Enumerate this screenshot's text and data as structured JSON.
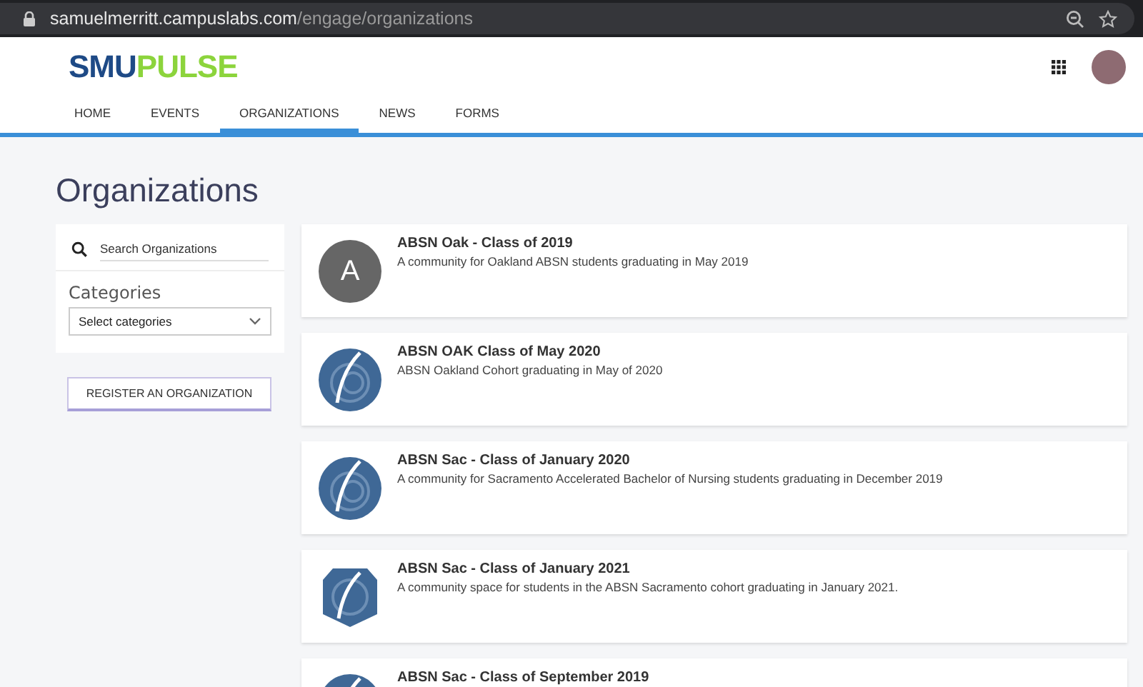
{
  "browser": {
    "url_host": "samuelmerritt.campuslabs.com",
    "url_path": "/engage/organizations"
  },
  "header": {
    "logo_primary": "SMU",
    "logo_secondary": "PULSE"
  },
  "nav": [
    {
      "label": "HOME",
      "selected": false
    },
    {
      "label": "EVENTS",
      "selected": false
    },
    {
      "label": "ORGANIZATIONS",
      "selected": true
    },
    {
      "label": "NEWS",
      "selected": false
    },
    {
      "label": "FORMS",
      "selected": false
    }
  ],
  "page_title": "Organizations",
  "sidebar": {
    "search": {
      "placeholder": "Search Organizations"
    },
    "categories_label": "Categories",
    "categories_select": "Select categories",
    "register_button": "REGISTER AN ORGANIZATION"
  },
  "organizations": [
    {
      "kind": "letter",
      "letter": "A",
      "name": "ABSN Oak - Class of 2019",
      "description": "A community for Oakland ABSN students graduating in May 2019"
    },
    {
      "kind": "round-logo",
      "name": "ABSN OAK Class of May 2020",
      "description": "ABSN Oakland Cohort graduating in May of 2020"
    },
    {
      "kind": "round-logo",
      "name": "ABSN Sac - Class of January 2020",
      "description": "A community for Sacramento Accelerated Bachelor of Nursing students graduating in December 2019"
    },
    {
      "kind": "shield-logo",
      "name": "ABSN Sac - Class of January 2021",
      "description": "A community space for students in the ABSN Sacramento cohort graduating in January 2021."
    },
    {
      "kind": "round-logo",
      "name": "ABSN Sac - Class of September 2019"
    }
  ]
}
